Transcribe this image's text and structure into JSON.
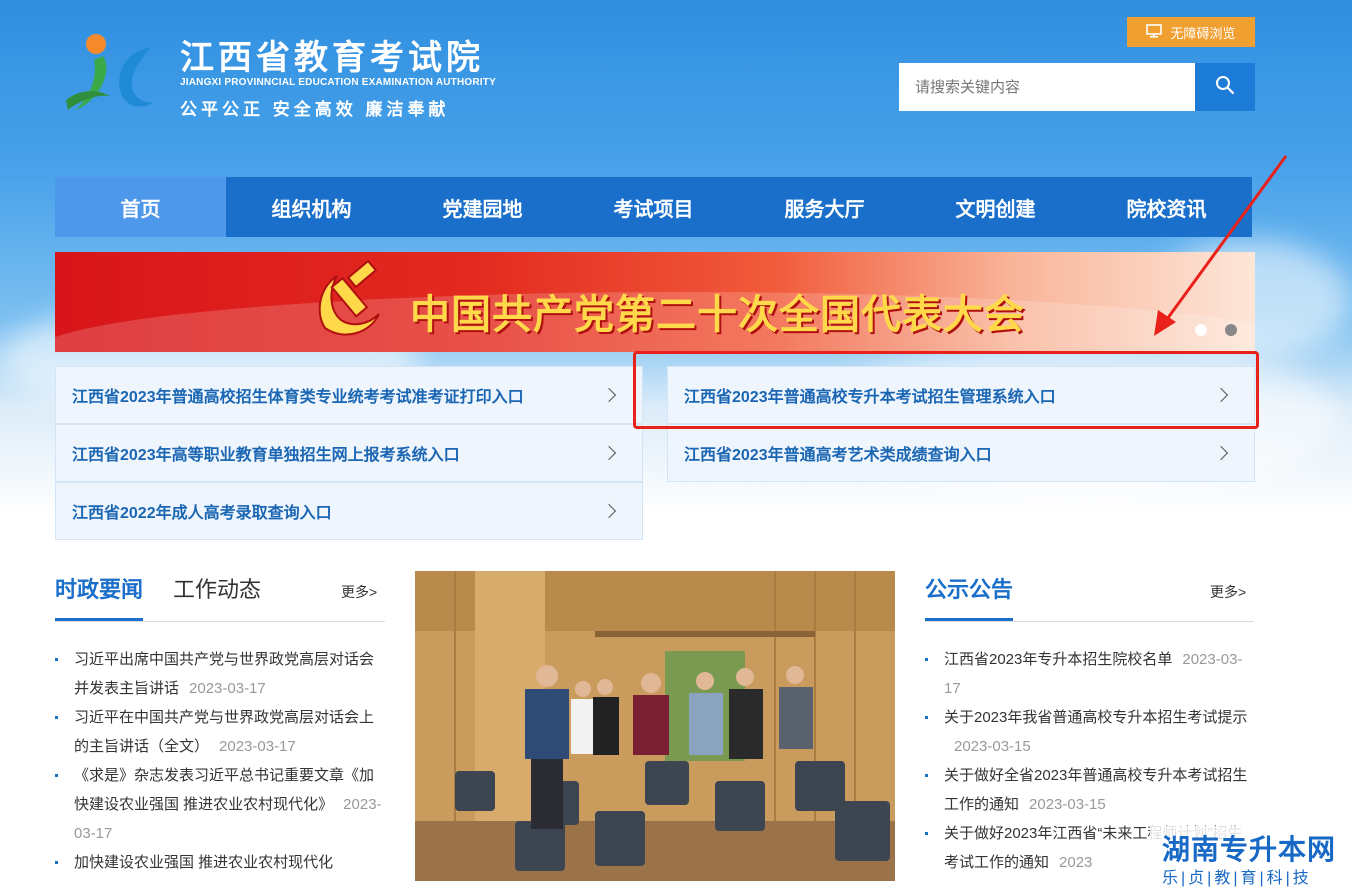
{
  "header": {
    "site_title": "江西省教育考试院",
    "site_title_en": "JIANGXI PROVINNCIAL EDUCATION EXAMINATION AUTHORITY",
    "motto": "公平公正  安全高效  廉洁奉献",
    "accessibility_label": "无障碍浏览",
    "search_placeholder": "请搜索关键内容"
  },
  "nav": {
    "items": [
      "首页",
      "组织机构",
      "党建园地",
      "考试项目",
      "服务大厅",
      "文明创建",
      "院校资讯"
    ],
    "active_index": 0
  },
  "banner": {
    "text": "中国共产党第二十次全国代表大会",
    "slides": 2,
    "active_slide": 1
  },
  "quick_links": [
    "江西省2023年普通高校招生体育类专业统考考试准考证打印入口",
    "江西省2023年普通高校专升本考试招生管理系统入口",
    "江西省2023年高等职业教育单独招生网上报考系统入口",
    "江西省2023年普通高考艺术类成绩查询入口",
    "江西省2022年成人高考录取查询入口"
  ],
  "news": {
    "tabs": [
      "时政要闻",
      "工作动态"
    ],
    "more_label": "更多>",
    "items": [
      {
        "title": "习近平出席中国共产党与世界政党高层对话会并发表主旨讲话",
        "date": "2023-03-17"
      },
      {
        "title": "习近平在中国共产党与世界政党高层对话会上的主旨讲话（全文）",
        "date": "2023-03-17"
      },
      {
        "title": "《求是》杂志发表习近平总书记重要文章《加快建设农业强国 推进农业农村现代化》",
        "date": "2023-03-17"
      },
      {
        "title": "加快建设农业强国 推进农业农村现代化",
        "date": ""
      }
    ]
  },
  "notices": {
    "title": "公示公告",
    "more_label": "更多>",
    "items": [
      {
        "title": "江西省2023年专升本招生院校名单",
        "date": "2023-03-17"
      },
      {
        "title": "关于2023年我省普通高校专升本招生考试提示",
        "date": "2023-03-15"
      },
      {
        "title": "关于做好全省2023年普通高校专升本考试招生工作的通知",
        "date": "2023-03-15"
      },
      {
        "title": "关于做好2023年江西省“未来工程师计划”招生考试工作的通知",
        "date": "2023"
      }
    ]
  },
  "watermark": {
    "title": "湖南专升本网",
    "subtitle": "乐|贞|教|育|科|技"
  },
  "colors": {
    "primary": "#1a6fcb",
    "nav_active": "#4d98ea",
    "accessibility_button": "#f0a030",
    "annotation_red": "#e8221b"
  }
}
